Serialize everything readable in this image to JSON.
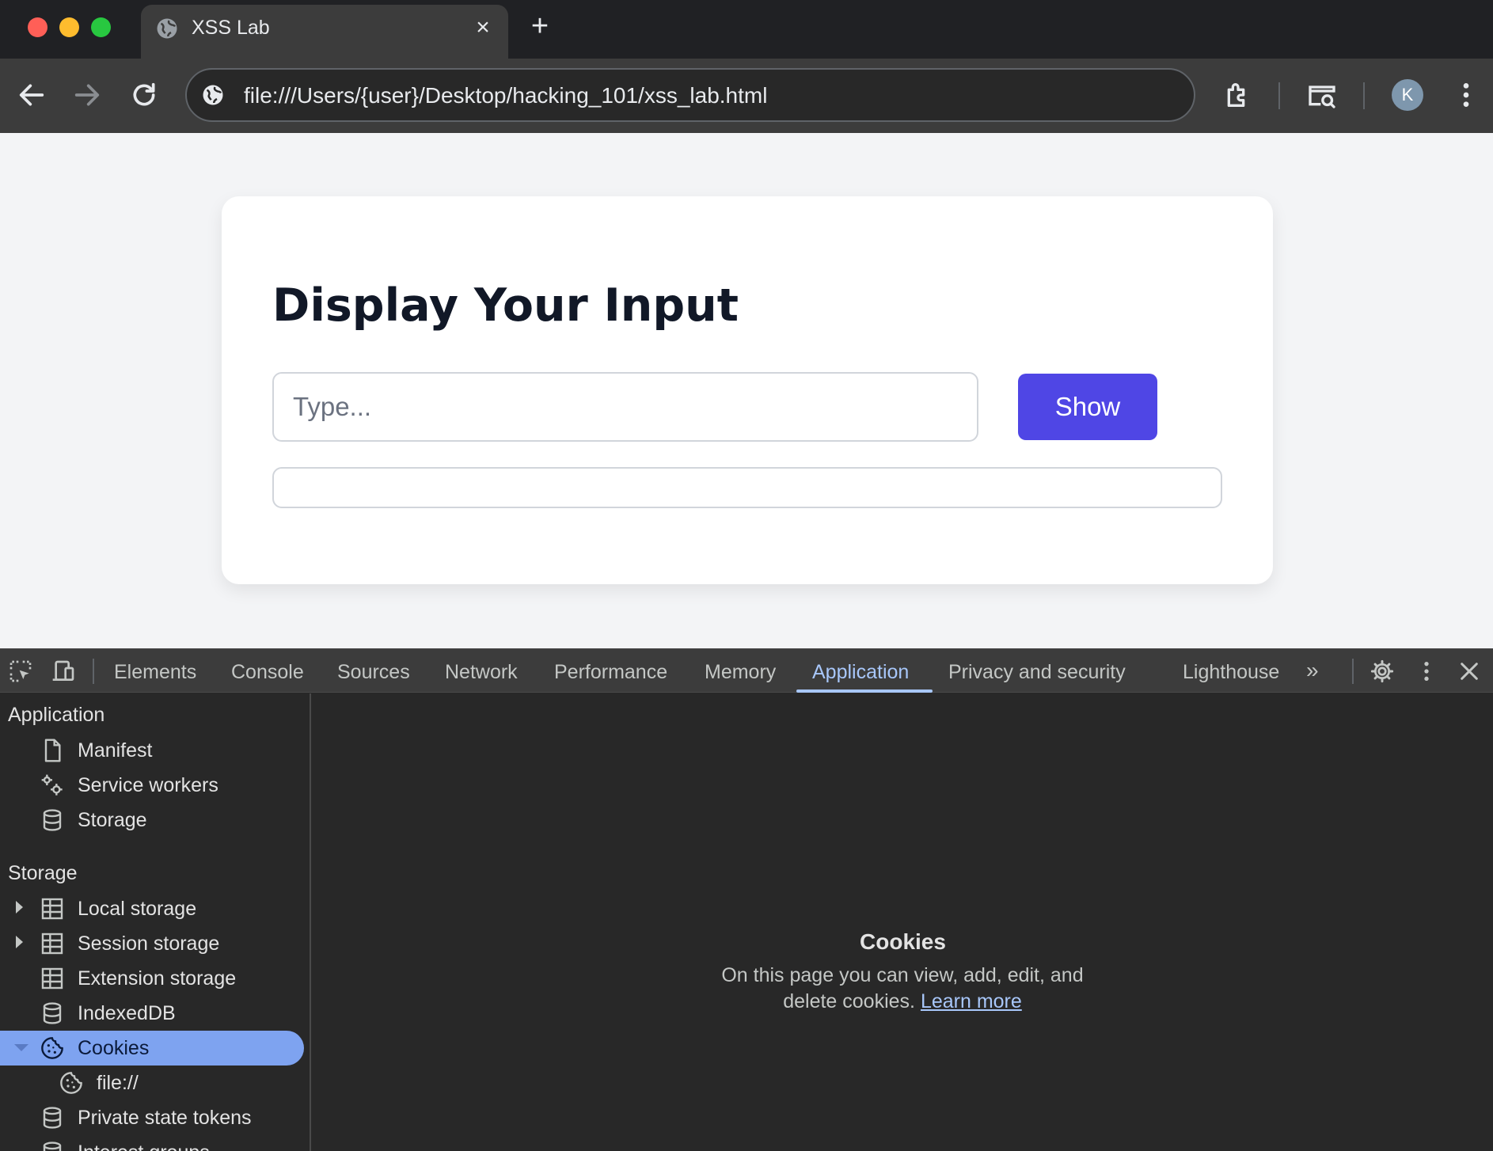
{
  "browser": {
    "tab": {
      "title": "XSS Lab"
    },
    "address_bar": {
      "url": "file:///Users/{user}/Desktop/hacking_101/xss_lab.html"
    },
    "profile_initial": "K"
  },
  "page": {
    "heading": "Display Your Input",
    "input": {
      "value": "",
      "placeholder": "Type..."
    },
    "show_button": "Show",
    "output": ""
  },
  "devtools": {
    "tabs": [
      "Elements",
      "Console",
      "Sources",
      "Network",
      "Performance",
      "Memory",
      "Application",
      "Privacy and security",
      "Lighthouse"
    ],
    "active_tab": "Application",
    "sidebar": {
      "application_section": {
        "title": "Application",
        "items": [
          {
            "label": "Manifest",
            "icon": "document-icon"
          },
          {
            "label": "Service workers",
            "icon": "gears-icon"
          },
          {
            "label": "Storage",
            "icon": "database-icon"
          }
        ]
      },
      "storage_section": {
        "title": "Storage",
        "items": [
          {
            "label": "Local storage",
            "icon": "table-icon",
            "expandable": true
          },
          {
            "label": "Session storage",
            "icon": "table-icon",
            "expandable": true
          },
          {
            "label": "Extension storage",
            "icon": "table-icon"
          },
          {
            "label": "IndexedDB",
            "icon": "database-icon"
          },
          {
            "label": "Cookies",
            "icon": "cookie-icon",
            "expanded": true,
            "selected": true
          },
          {
            "label": "file://",
            "icon": "cookie-icon",
            "child": true
          },
          {
            "label": "Private state tokens",
            "icon": "database-icon"
          },
          {
            "label": "Interest groups",
            "icon": "database-icon"
          }
        ]
      }
    },
    "main": {
      "title": "Cookies",
      "description": "On this page you can view, add, edit, and delete cookies.",
      "link": "Learn more"
    }
  },
  "colors": {
    "accent_button": "#4f46e5",
    "devtools_active": "#a8c7fa",
    "selected_row": "#7ea3f0"
  }
}
